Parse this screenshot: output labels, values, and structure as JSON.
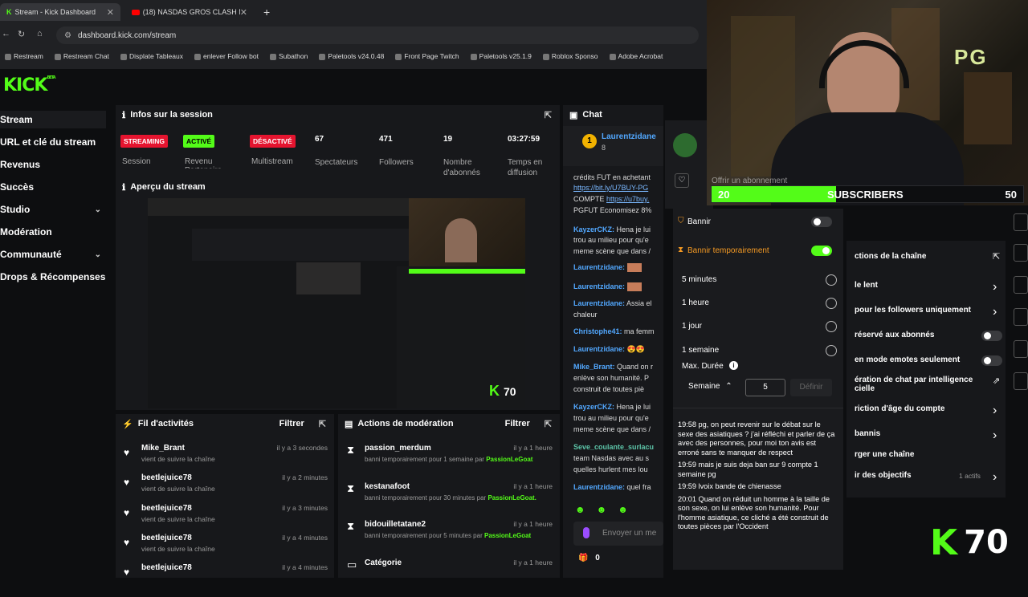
{
  "browser": {
    "tabs": [
      {
        "label": "Stream - Kick Dashboard"
      },
      {
        "label": "(18) NASDAS GROS CLASH NA..."
      }
    ],
    "new_tab": "+",
    "url": "dashboard.kick.com/stream",
    "bookmarks": [
      "Restream",
      "Restream Chat",
      "Displate Tableaux",
      "enlever Follow bot",
      "Subathon",
      "Paletools v24.0.48",
      "Front Page Twitch",
      "Paletools v25.1.9",
      "Roblox Sponso",
      "Adobe Acrobat"
    ]
  },
  "brand": {
    "logo": "KICK",
    "beta": "BETA",
    "accent": "#53fc18"
  },
  "sidebar": {
    "items": [
      {
        "label": "Stream"
      },
      {
        "label": "URL et clé du stream"
      },
      {
        "label": "Revenus"
      },
      {
        "label": "Succès"
      },
      {
        "label": "Studio"
      },
      {
        "label": "Modération"
      },
      {
        "label": "Communauté"
      },
      {
        "label": "Drops & Récompenses"
      }
    ]
  },
  "session": {
    "title": "Infos sur la session",
    "badges": [
      {
        "text": "STREAMING",
        "label": "Session",
        "color": "#e5142f"
      },
      {
        "text": "ACTIVÉ",
        "label": "Revenu Partenaire",
        "color": "#53fc18"
      },
      {
        "text": "DÉSACTIVÉ",
        "label": "Multistream",
        "color": "#e5142f"
      }
    ],
    "stats": [
      {
        "value": "67",
        "label": "Spectateurs"
      },
      {
        "value": "471",
        "label": "Followers"
      },
      {
        "value": "19",
        "label": "Nombre d'abonnés"
      },
      {
        "value": "03:27:59",
        "label": "Temps en diffusion"
      }
    ]
  },
  "preview": {
    "title": "Aperçu du stream"
  },
  "activity": {
    "title": "Fil d'activités",
    "filter": "Filtrer",
    "items": [
      {
        "name": "Mike_Brant",
        "action": "vient de suivre la chaîne",
        "time": "il y a 3 secondes"
      },
      {
        "name": "beetlejuice78",
        "action": "vient de suivre la chaîne",
        "time": "il y a 2 minutes"
      },
      {
        "name": "beetlejuice78",
        "action": "vient de suivre la chaîne",
        "time": "il y a 3 minutes"
      },
      {
        "name": "beetlejuice78",
        "action": "vient de suivre la chaîne",
        "time": "il y a 4 minutes"
      },
      {
        "name": "beetlejuice78",
        "action": "",
        "time": "il y a 4 minutes"
      }
    ]
  },
  "moderation": {
    "title": "Actions de modération",
    "filter": "Filtrer",
    "items": [
      {
        "name": "passion_merdum",
        "action": "banni temporairement pour 1 semaine par",
        "by": "PassionLeGoat",
        "time": "il y a 1 heure"
      },
      {
        "name": "kestanafoot",
        "action": "banni temporairement pour 30 minutes par",
        "by": "PassionLeGoat.",
        "time": "il y a 1 heure"
      },
      {
        "name": "bidouilletatane2",
        "action": "banni temporairement pour 5 minutes par",
        "by": "PassionLeGoat",
        "time": "il y a 1 heure"
      },
      {
        "name": "Catégorie",
        "action": "",
        "by": "",
        "time": "il y a 1 heure"
      }
    ]
  },
  "chat": {
    "title": "Chat",
    "pinned_user": "Laurentzidane",
    "pinned_sub": "8",
    "lines": [
      {
        "user": "",
        "text": "crédits FUT en achetant"
      },
      {
        "user": "",
        "link": "https://bit.ly/U7BUY-PG"
      },
      {
        "user": "",
        "text": "COMPTE ",
        "link": "https://u7buy."
      },
      {
        "user": "",
        "text": "PGFUT Economisez 8%"
      },
      {
        "user": "KayzerCKZ:",
        "text": " Hena je lui"
      },
      {
        "user": "",
        "text": "trou au milieu pour qu'e"
      },
      {
        "user": "",
        "text": "meme scène que dans /"
      },
      {
        "user": "Laurentzidane:",
        "text": ""
      },
      {
        "user": "Laurentzidane:",
        "text": ""
      },
      {
        "user": "Laurentzidane:",
        "text": " Assia el"
      },
      {
        "user": "",
        "text": "chaleur"
      },
      {
        "user": "Christophe41:",
        "text": " ma femm"
      },
      {
        "user": "Laurentzidane:",
        "text": " 😍😍"
      },
      {
        "user": "Mike_Brant:",
        "text": " Quand on r"
      },
      {
        "user": "",
        "text": "enlève son humanité. P"
      },
      {
        "user": "",
        "text": "construit de toutes piè"
      },
      {
        "user": "KayzerCKZ:",
        "text": " Hena je lui"
      },
      {
        "user": "",
        "text": "trou au milieu pour qu'e"
      },
      {
        "user": "",
        "text": "meme scène que dans /"
      },
      {
        "user": "Seve_coulante_surlacu",
        "text": ""
      },
      {
        "user": "",
        "text": "team Nasdas avec au s"
      },
      {
        "user": "",
        "text": "quelles hurlent mes lou"
      },
      {
        "user": "Laurentzidane:",
        "text": " quel fra"
      }
    ],
    "input_placeholder": "Envoyer un me",
    "footer_count": "0"
  },
  "ban_popup": {
    "ban_label": "Bannir",
    "temp_ban_label": "Bannir temporairement",
    "options": [
      "5 minutes",
      "1 heure",
      "1 jour",
      "1 semaine"
    ],
    "max_label": "Max. Durée",
    "unit": "Semaine",
    "value": "5",
    "define": "Définir",
    "log": [
      "19:58 pg, on peut revenir sur le débat sur le sexe des asiatiques ? j'ai réfléchi et parler de ça avec des personnes, pour moi ton avis est erroné sans te manquer de respect",
      "19:59 mais je suis deja ban sur 9 compte 1 semaine pg",
      "19:59 lvoix bande de chienasse",
      "20:01 Quand on réduit un homme à la taille de son sexe, on lui enlève son humanité. Pour l'homme asiatique, ce cliché a été construit de toutes pièces par l'Occident"
    ]
  },
  "mod_actions": {
    "title": "ctions de la chaîne",
    "rows": [
      {
        "label": "le lent",
        "control": "arrow"
      },
      {
        "label": "pour les followers uniquement",
        "control": "arrow"
      },
      {
        "label": "réservé aux abonnés",
        "control": "toggle"
      },
      {
        "label": "en mode emotes seulement",
        "control": "toggle"
      },
      {
        "label": "ération de chat par intelligence",
        "label2": "cielle",
        "control": "ext"
      },
      {
        "label": "riction d'âge du compte",
        "control": "arrow"
      },
      {
        "label": "bannis",
        "control": "arrow"
      },
      {
        "label": "rger une chaîne",
        "control": ""
      },
      {
        "label": "ir des objectifs",
        "control": "arrow",
        "extra": "1 actifs"
      }
    ]
  },
  "overlay": {
    "sub_left": "20",
    "sub_label": "SUBSCRIBERS",
    "sub_right": "50",
    "sub_progress": 0.4,
    "goal_header": "Offrir un abonnement",
    "pg_logo": "PG",
    "kick_count": "70",
    "kick_letter": "K"
  }
}
